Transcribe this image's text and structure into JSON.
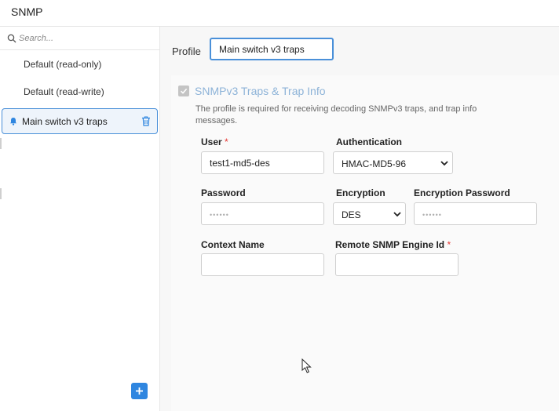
{
  "app": {
    "title": "SNMP"
  },
  "sidebar": {
    "search_placeholder": "Search...",
    "items": [
      {
        "label": "Default (read-only)"
      },
      {
        "label": "Default (read-write)"
      },
      {
        "label": "Main switch v3 traps",
        "selected": true
      }
    ],
    "icons": {
      "search": "search-icon",
      "selected_item": "bell-icon",
      "delete": "trash-icon",
      "add": "plus-icon"
    }
  },
  "main": {
    "profile_label": "Profile",
    "profile_value": "Main switch v3 traps",
    "section": {
      "checked": true,
      "title": "SNMPv3 Traps & Trap Info",
      "description": "The profile is required for receiving decoding SNMPv3 traps, and trap info messages."
    },
    "fields": {
      "user": {
        "label": "User",
        "required_mark": "*",
        "value": "test1-md5-des"
      },
      "authentication": {
        "label": "Authentication",
        "value": "HMAC-MD5-96"
      },
      "password": {
        "label": "Password",
        "placeholder": "••••••"
      },
      "encryption": {
        "label": "Encryption",
        "value": "DES"
      },
      "encryption_password": {
        "label": "Encryption Password",
        "placeholder": "••••••"
      },
      "context_name": {
        "label": "Context Name",
        "value": ""
      },
      "remote_engine_id": {
        "label": "Remote SNMP Engine Id",
        "required_mark": "*",
        "value": ""
      }
    }
  },
  "colors": {
    "accent": "#2f86e0",
    "selected_border": "#4a90d9",
    "required": "#e53935",
    "section_title": "#8db3d8"
  }
}
